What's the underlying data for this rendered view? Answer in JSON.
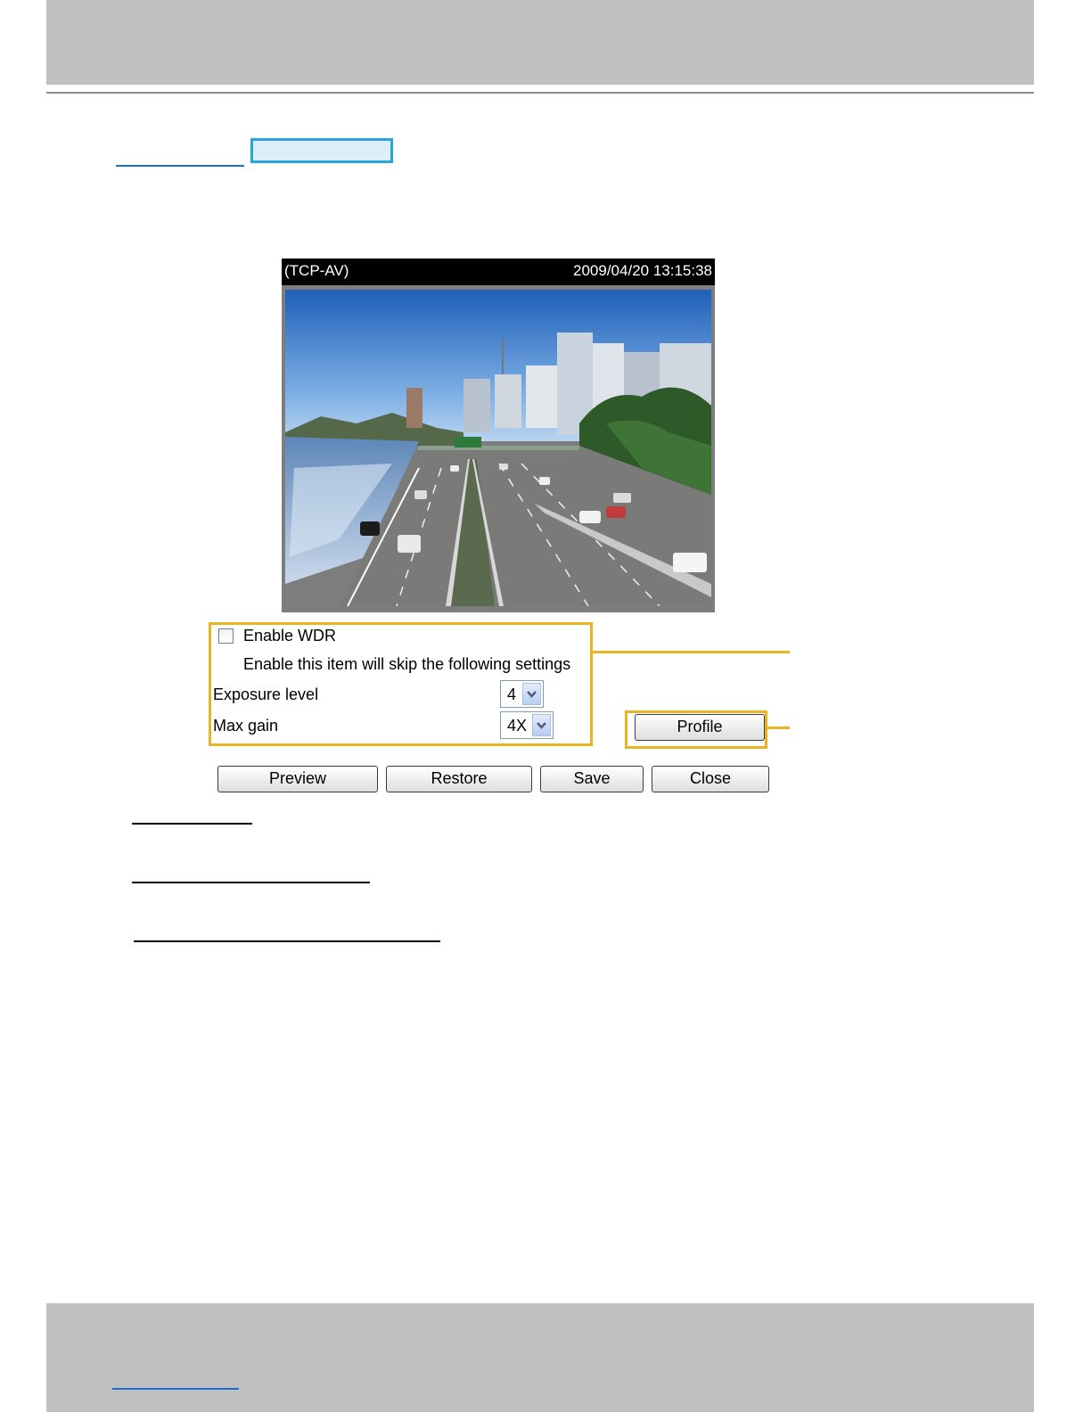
{
  "viewer": {
    "protocol": "(TCP-AV)",
    "timestamp": "2009/04/20 13:15:38"
  },
  "wdr": {
    "enable_label": "Enable WDR",
    "enabled": false,
    "note": "Enable this item will skip the following settings"
  },
  "exposure": {
    "label": "Exposure level",
    "value": "4"
  },
  "gain": {
    "label": "Max gain",
    "value": "4X"
  },
  "buttons": {
    "profile": "Profile",
    "preview": "Preview",
    "restore": "Restore",
    "save": "Save",
    "close": "Close"
  },
  "colors": {
    "callout": "#e8b421",
    "highlight_border": "#2aa5dc",
    "band": "#c0c0c0"
  }
}
